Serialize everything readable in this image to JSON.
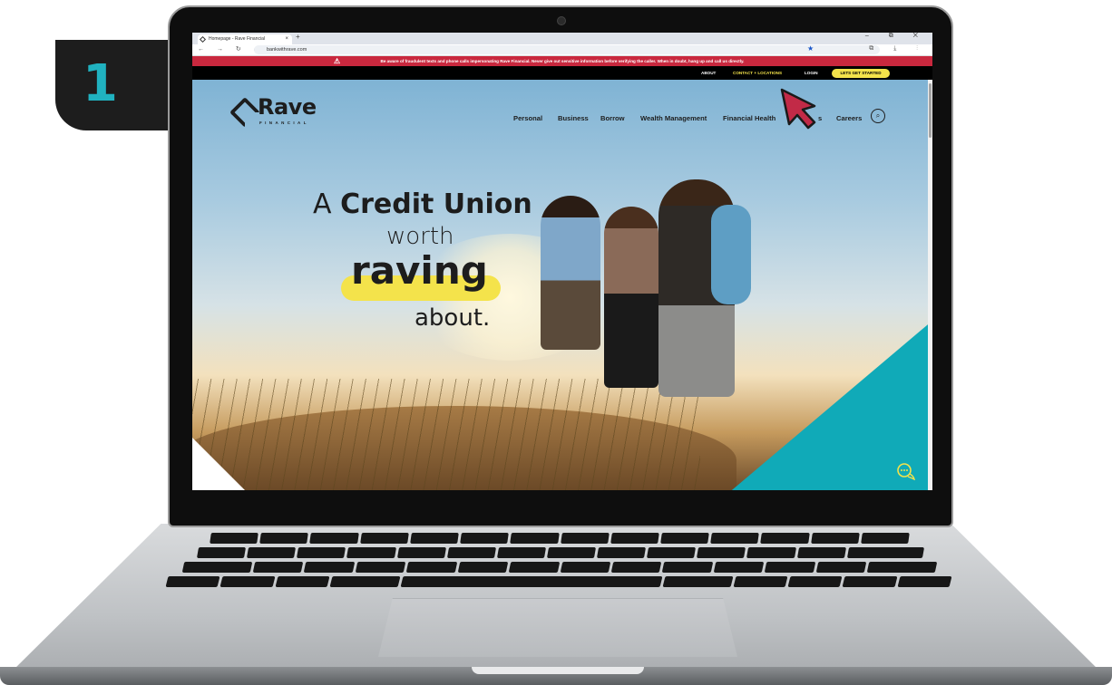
{
  "step_badge": {
    "number": "1"
  },
  "browser": {
    "tab_title": "Homepage - Rave Financial",
    "tab_close": "×",
    "new_tab": "+",
    "window_controls": "–  ⧉  ✕",
    "nav_icons": "←  →  ↻  ⌂",
    "url": "bankwithrave.com",
    "bookmark_icon": "star-icon"
  },
  "site": {
    "alert": "Be aware of fraudulent texts and phone calls impersonating Rave Financial. Never give out sensitive information before verifying the caller. When in doubt, hang up and call us directly.",
    "utility_nav": {
      "about": "ABOUT",
      "contact": "CONTACT + LOCATIONS",
      "login": "LOGIN",
      "cta": "LETS GET STARTED"
    },
    "logo": {
      "name": "Rave",
      "subtitle": "FINANCIAL"
    },
    "main_nav": {
      "personal": "Personal",
      "business": "Business",
      "borrow": "Borrow",
      "wealth": "Wealth Management",
      "health": "Financial Health",
      "partial": "s",
      "careers": "Careers"
    },
    "hero": {
      "line1_a": "A ",
      "line1_b": "Credit Union",
      "line2": "worth",
      "line3": "raving",
      "line4": "about."
    }
  },
  "colors": {
    "accent_yellow": "#f4e34b",
    "alert_red": "#c9283e",
    "teal": "#10aab8",
    "cursor_red": "#c22a47",
    "badge_teal": "#20b2c0"
  }
}
